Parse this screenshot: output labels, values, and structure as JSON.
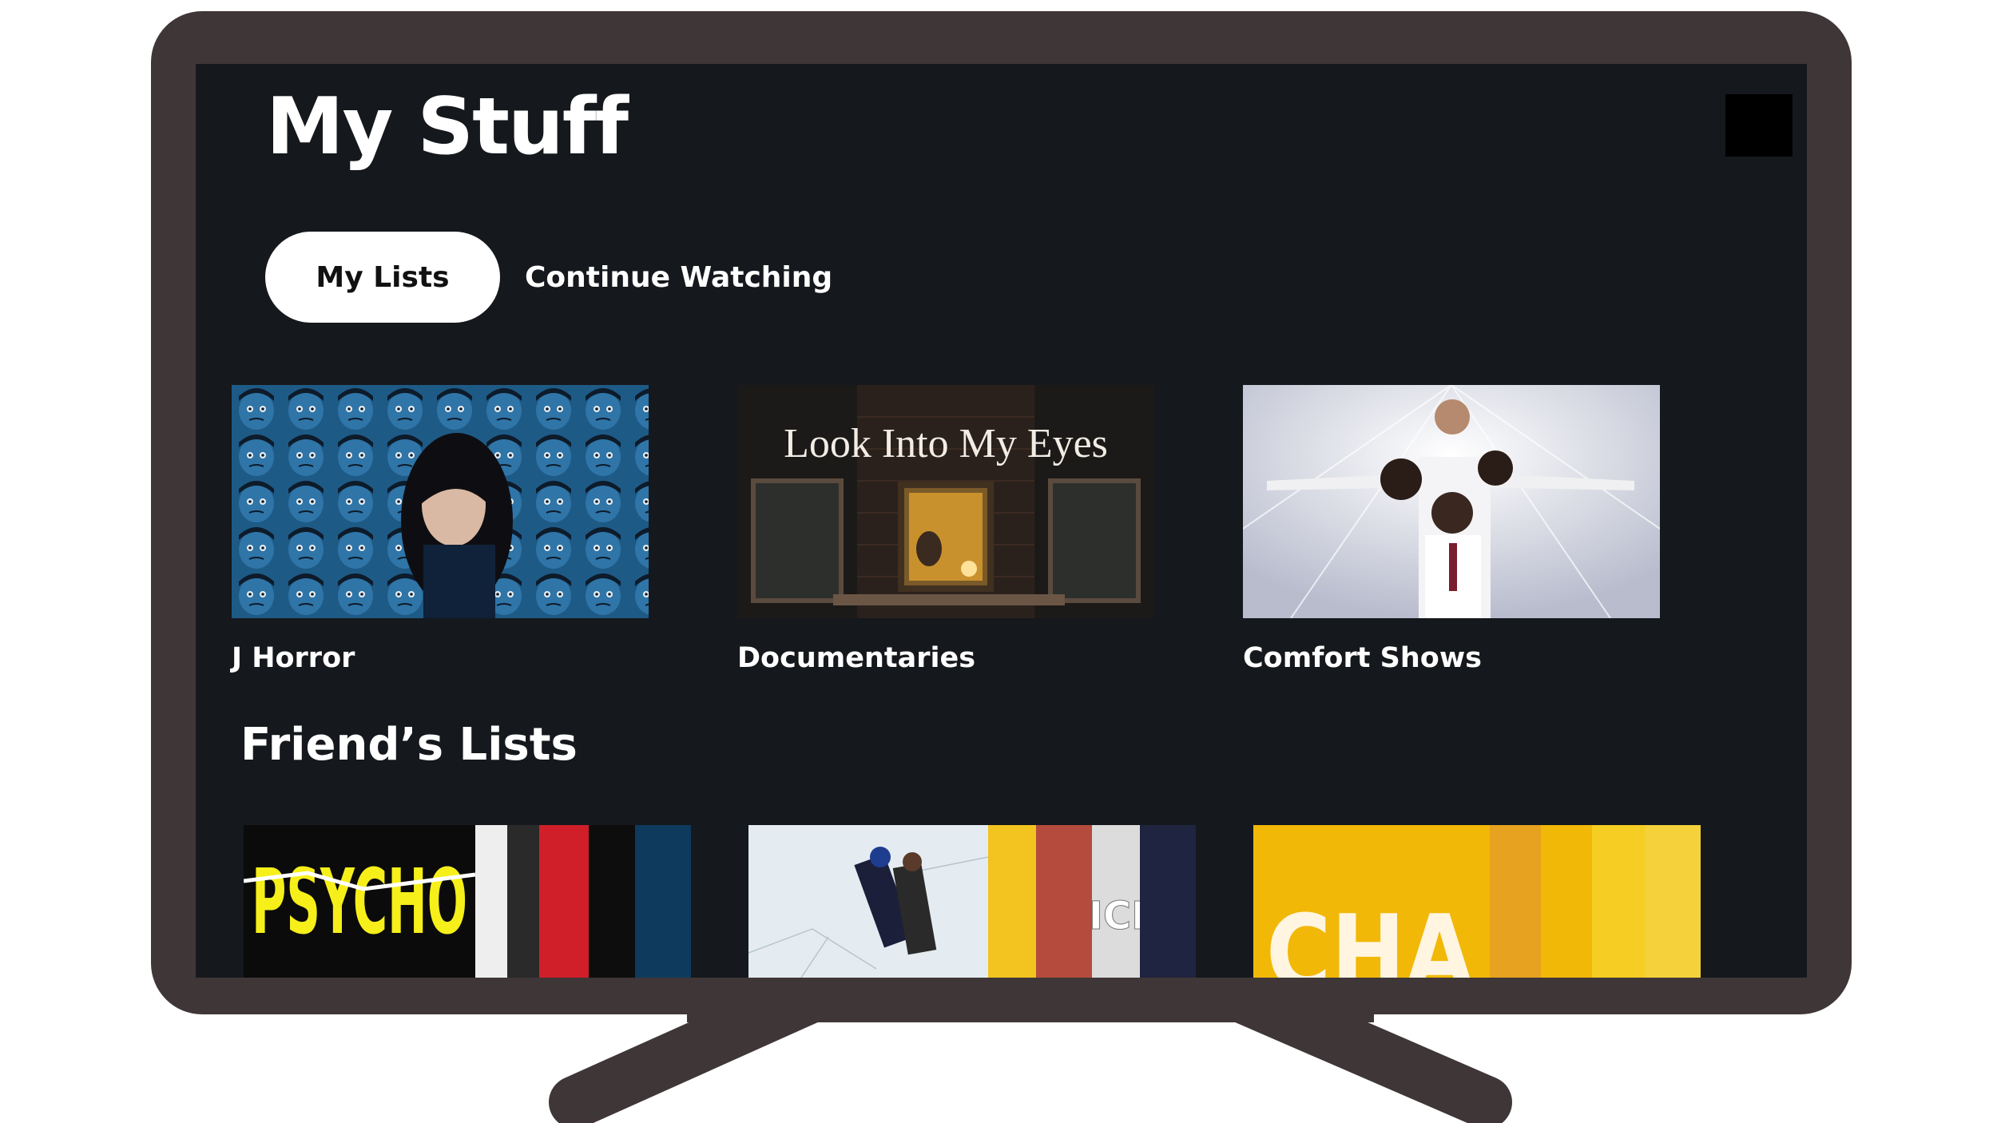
{
  "header": {
    "title": "My Stuff"
  },
  "tabs": [
    {
      "label": "My Lists",
      "active": true
    },
    {
      "label": "Continue Watching",
      "active": false
    }
  ],
  "my_lists": [
    {
      "label": "J Horror"
    },
    {
      "label": "Documentaries",
      "thumb_text": "Look Into My Eyes"
    },
    {
      "label": "Comfort Shows"
    }
  ],
  "friends_section": {
    "title": "Friend’s Lists"
  },
  "friends_lists": [
    {
      "poster_text": "PSYCHO"
    },
    {
      "poster_text": "ICE"
    },
    {
      "poster_text": "CHA"
    }
  ],
  "colors": {
    "screen_bg": "#15181c",
    "tv_frame": "#3f3637",
    "accent_yellow": "#f2b807"
  }
}
